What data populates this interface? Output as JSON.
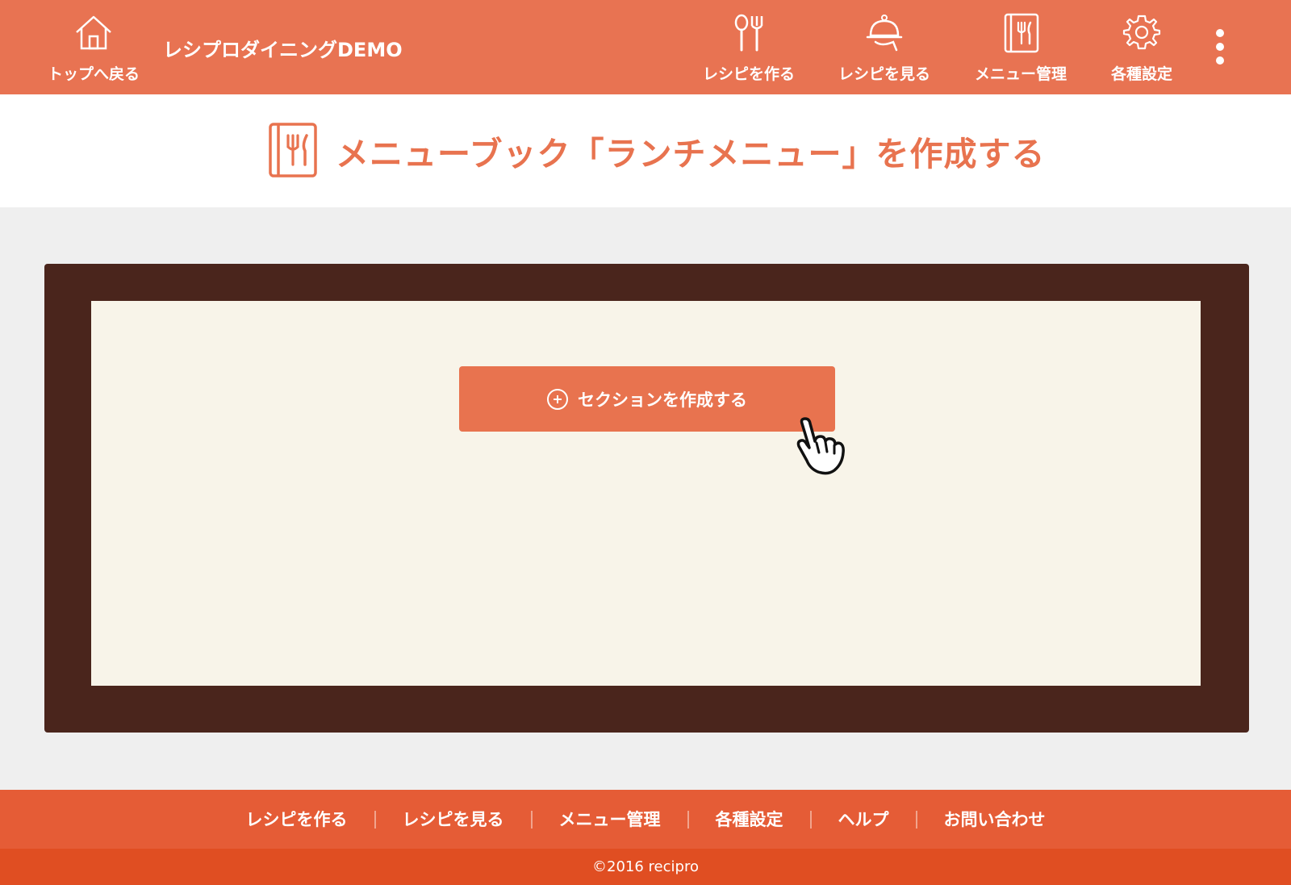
{
  "header": {
    "home_label": "トップへ戻る",
    "app_title": "レシプロダイニングDEMO",
    "nav": [
      {
        "label": "レシピを作る",
        "icon": "spoon-fork-icon"
      },
      {
        "label": "レシピを見る",
        "icon": "cloche-icon"
      },
      {
        "label": "メニュー管理",
        "icon": "menu-book-icon"
      },
      {
        "label": "各種設定",
        "icon": "gear-icon"
      }
    ],
    "more_icon": "kebab-menu-icon"
  },
  "page": {
    "title": "メニューブック「ランチメニュー」を作成する",
    "title_icon": "menu-book-icon"
  },
  "editor": {
    "create_section_label": "セクションを作成する",
    "create_section_icon": "plus-circle-icon"
  },
  "footer": {
    "links": [
      "レシピを作る",
      "レシピを見る",
      "メニュー管理",
      "各種設定",
      "ヘルプ",
      "お問い合わせ"
    ],
    "copyright": "©2016 recipro"
  },
  "colors": {
    "accent": "#e87352",
    "board": "#4a251c",
    "canvas": "#f8f4e9",
    "footer": "#e55c36",
    "copyright_bar": "#e04e22"
  }
}
